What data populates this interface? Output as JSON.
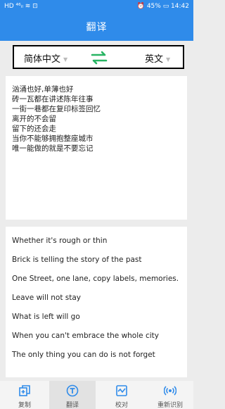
{
  "status": {
    "left": "HD ⁴⁶ᵢₗ ≋ ⊡",
    "right": "⏰ 45% ▭ 14:42"
  },
  "header": {
    "title": "翻译"
  },
  "language": {
    "source": "简体中文",
    "target": "英文",
    "swap_icon": "swap-arrows-icon"
  },
  "source_text": [
    "汹涌也好,单薄也好",
    "砖一瓦都在讲述陈年往事",
    "一街一巷都在复印标签回忆",
    "离开的不会留",
    "留下的还会走",
    "当你不能够拥抱整座城市",
    "唯一能做的就是不要忘记"
  ],
  "result_text": [
    "Whether it's rough or thin",
    "Brick is telling the story of the past",
    "One Street, one lane, copy labels, memories.",
    "Leave will not stay",
    "What is left will go",
    "When you can't embrace the whole city",
    "The only thing you can do is not forget"
  ],
  "tabs": [
    {
      "label": "复制",
      "icon": "copy-icon"
    },
    {
      "label": "翻译",
      "icon": "translate-icon"
    },
    {
      "label": "校对",
      "icon": "proofread-icon"
    },
    {
      "label": "重新识别",
      "icon": "rescan-icon"
    }
  ],
  "colors": {
    "accent": "#2f8bea",
    "swap_green": "#28b463"
  }
}
